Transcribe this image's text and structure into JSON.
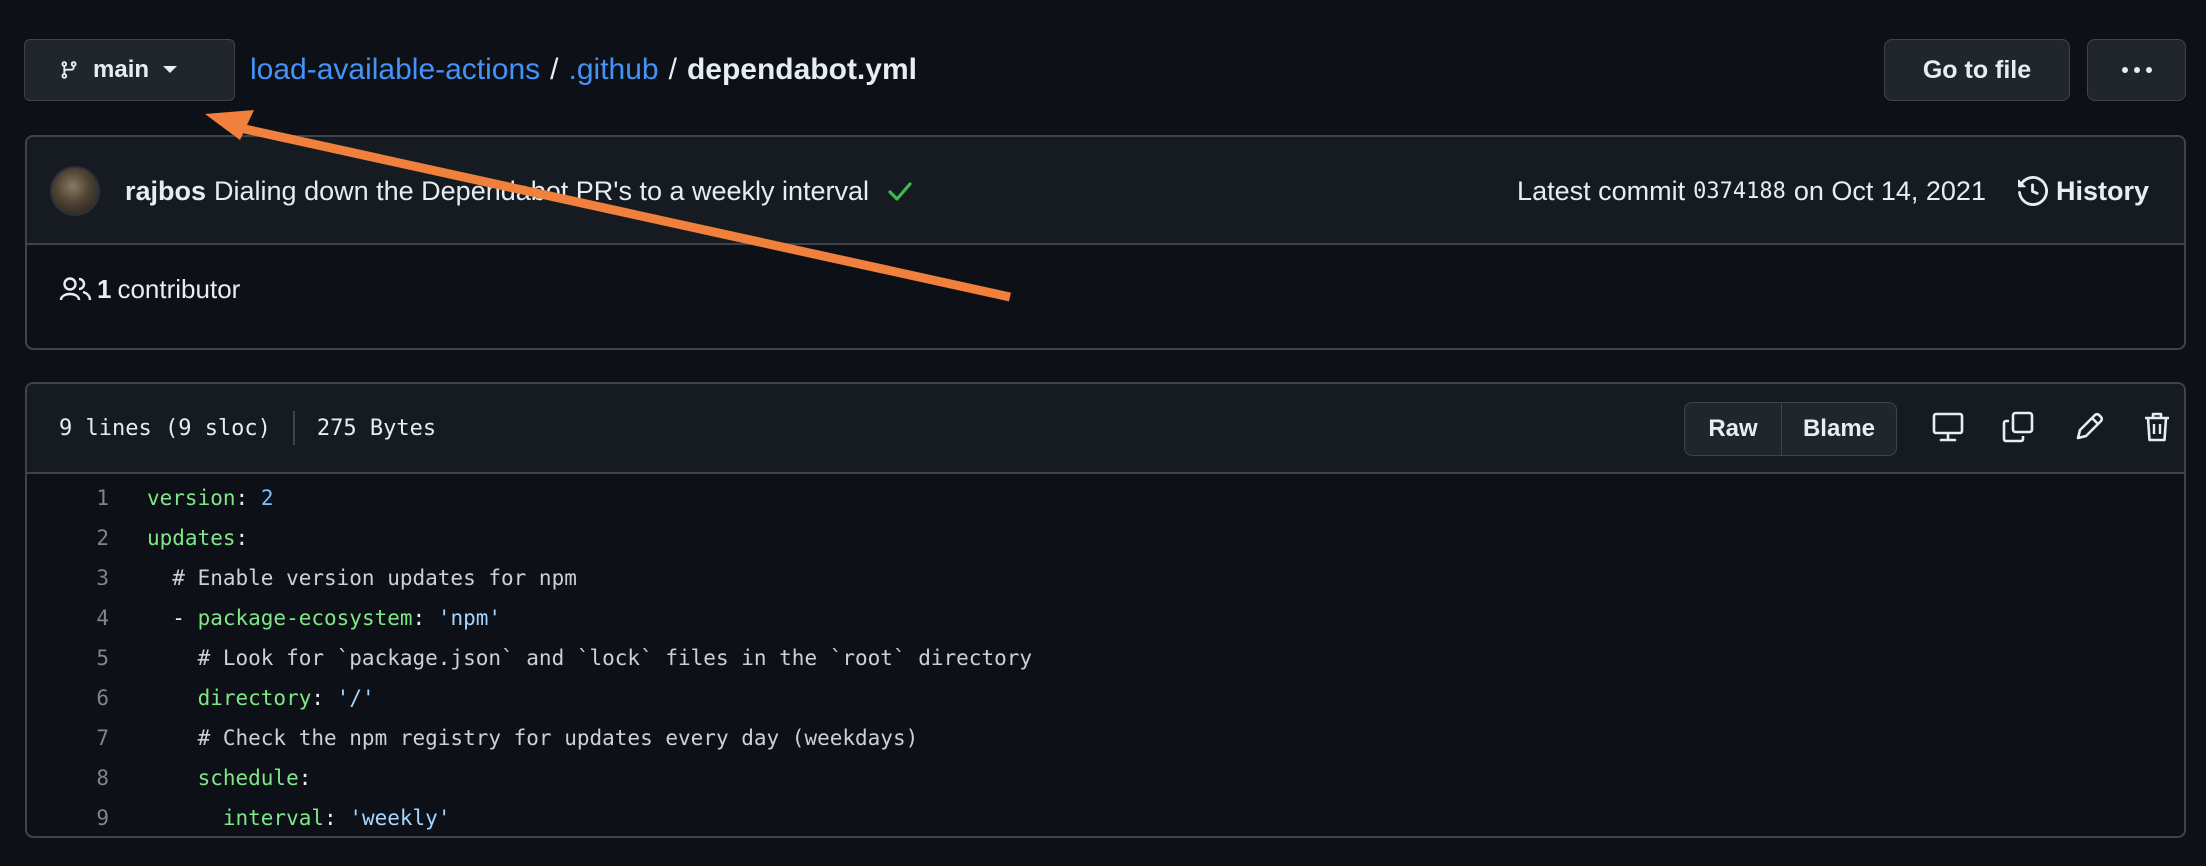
{
  "branch": {
    "name": "main"
  },
  "breadcrumb": {
    "repo": "load-available-actions",
    "sep1": "/",
    "folder": ".github",
    "sep2": "/",
    "file": "dependabot.yml"
  },
  "actions": {
    "go_to_file": "Go to file",
    "more": "···"
  },
  "commit": {
    "author": "rajbos",
    "message": "Dialing down the Dependabot PR's to a weekly interval",
    "latest_label": "Latest commit",
    "sha": "0374188",
    "date_text": "on Oct 14, 2021",
    "history_label": "History"
  },
  "contributors": {
    "count": "1",
    "label": "contributor"
  },
  "file_info": {
    "lines": "9 lines (9 sloc)",
    "size": "275 Bytes",
    "raw_label": "Raw",
    "blame_label": "Blame"
  },
  "code_lines": [
    "1",
    "2",
    "3",
    "4",
    "5",
    "6",
    "7",
    "8",
    "9"
  ],
  "code": {
    "l1_key": "version",
    "l1_colon": ": ",
    "l1_val": "2",
    "l2_key": "updates",
    "l2_colon": ":",
    "l3": "  # Enable version updates for npm",
    "l4_dash": "  - ",
    "l4_key": "package-ecosystem",
    "l4_colon": ": ",
    "l4_val": "'npm'",
    "l5": "    # Look for `package.json` and `lock` files in the `root` directory",
    "l6_indent": "    ",
    "l6_key": "directory",
    "l6_colon": ": ",
    "l6_val": "'/'",
    "l7": "    # Check the npm registry for updates every day (weekdays)",
    "l8_indent": "    ",
    "l8_key": "schedule",
    "l8_colon": ":",
    "l9_indent": "      ",
    "l9_key": "interval",
    "l9_colon": ": ",
    "l9_val": "'weekly'"
  },
  "colors": {
    "background": "#0d1117",
    "link": "#4493f8",
    "arrow": "#f0803c",
    "success": "#3fb950",
    "yaml_key": "#7ee787"
  }
}
